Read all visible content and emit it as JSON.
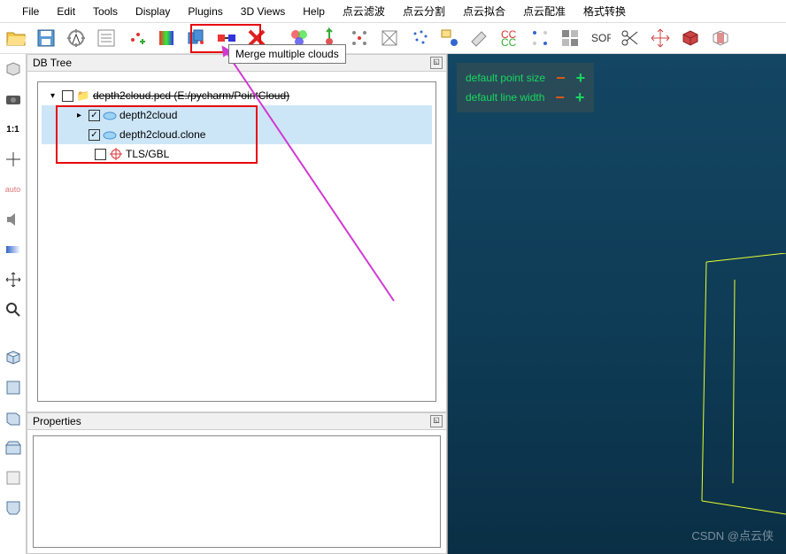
{
  "menu": [
    "File",
    "Edit",
    "Tools",
    "Display",
    "Plugins",
    "3D Views",
    "Help",
    "点云滤波",
    "点云分割",
    "点云拟合",
    "点云配准",
    "格式转换"
  ],
  "tooltip": "Merge multiple clouds",
  "panels": {
    "tree_title": "DB Tree",
    "props_title": "Properties"
  },
  "tree": {
    "root": "depth2cloud.pcd (E:/pycharm/PointCloud)",
    "child1": "depth2cloud",
    "child2": "depth2cloud.clone",
    "child3": "TLS/GBL"
  },
  "viewport": {
    "line1": "default point size",
    "line2": "default line width"
  },
  "leftbar_ratio": "1:1",
  "leftbar_auto": "auto",
  "watermark": "CSDN @点云侠"
}
